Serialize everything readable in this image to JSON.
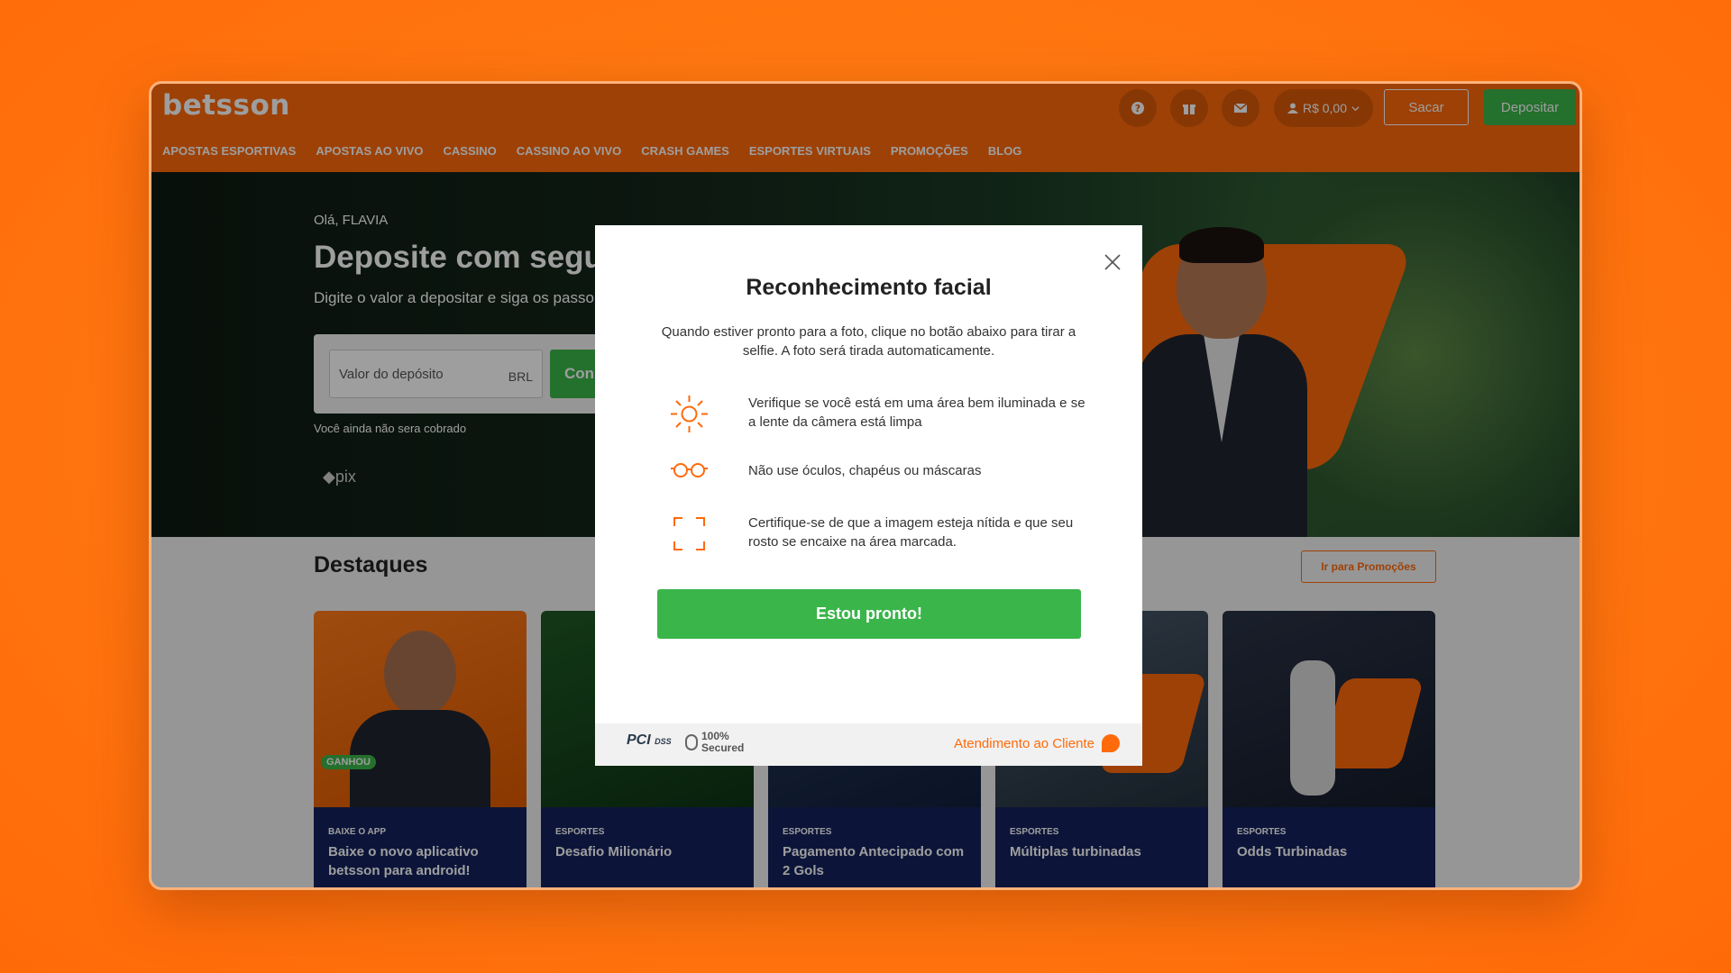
{
  "header": {
    "logo": "betsson",
    "balance": "R$ 0,00",
    "sacar": "Sacar",
    "depositar": "Depositar",
    "help_icon": "question-icon",
    "gift_icon": "gift-icon",
    "mail_icon": "mail-icon",
    "user_icon": "user-icon"
  },
  "nav": {
    "items": [
      "APOSTAS ESPORTIVAS",
      "APOSTAS AO VIVO",
      "CASSINO",
      "CASSINO AO VIVO",
      "CRASH GAMES",
      "ESPORTES VIRTUAIS",
      "PROMOÇÕES",
      "BLOG"
    ]
  },
  "hero": {
    "greeting": "Olá, FLAVIA",
    "title": "Deposite com segu",
    "subtitle": "Digite o valor a depositar e siga os passo",
    "input_placeholder": "Valor do depósito",
    "currency": "BRL",
    "cta": "Con",
    "note": "Você ainda não sera cobrado",
    "pix": "pix"
  },
  "destaques": {
    "title": "Destaques",
    "promos_button": "Ir para Promoções",
    "cards": [
      {
        "category": "BAIXE O APP",
        "title": "Baixe o novo aplicativo betsson para android!",
        "badge": "GANHOU"
      },
      {
        "category": "ESPORTES",
        "title": "Desafio Milionário"
      },
      {
        "category": "ESPORTES",
        "title": "Pagamento Antecipado com 2 Gols"
      },
      {
        "category": "ESPORTES",
        "title": "Múltiplas turbinadas"
      },
      {
        "category": "ESPORTES",
        "title": "Odds Turbinadas"
      }
    ]
  },
  "modal": {
    "title": "Reconhecimento facial",
    "description": "Quando estiver pronto para a foto, clique no botão abaixo para tirar a selfie. A foto será tirada automaticamente.",
    "tips": [
      {
        "icon": "sun-icon",
        "text": "Verifique se você está em uma área bem iluminada e se a lente da câmera está limpa"
      },
      {
        "icon": "glasses-icon",
        "text": "Não use óculos, chapéus ou máscaras"
      },
      {
        "icon": "focus-frame-icon",
        "text": "Certifique-se de que a imagem esteja nítida e que seu rosto se encaixe na área marcada."
      }
    ],
    "button": "Estou pronto!",
    "footer": {
      "pci": "PCI",
      "dss": "DSS",
      "secured_top": "100%",
      "secured_bottom": "Secured",
      "support": "Atendimento ao Cliente"
    }
  },
  "colors": {
    "brand_orange": "#ff6a0b",
    "cta_green": "#3ab54a",
    "card_navy": "#14225c"
  }
}
